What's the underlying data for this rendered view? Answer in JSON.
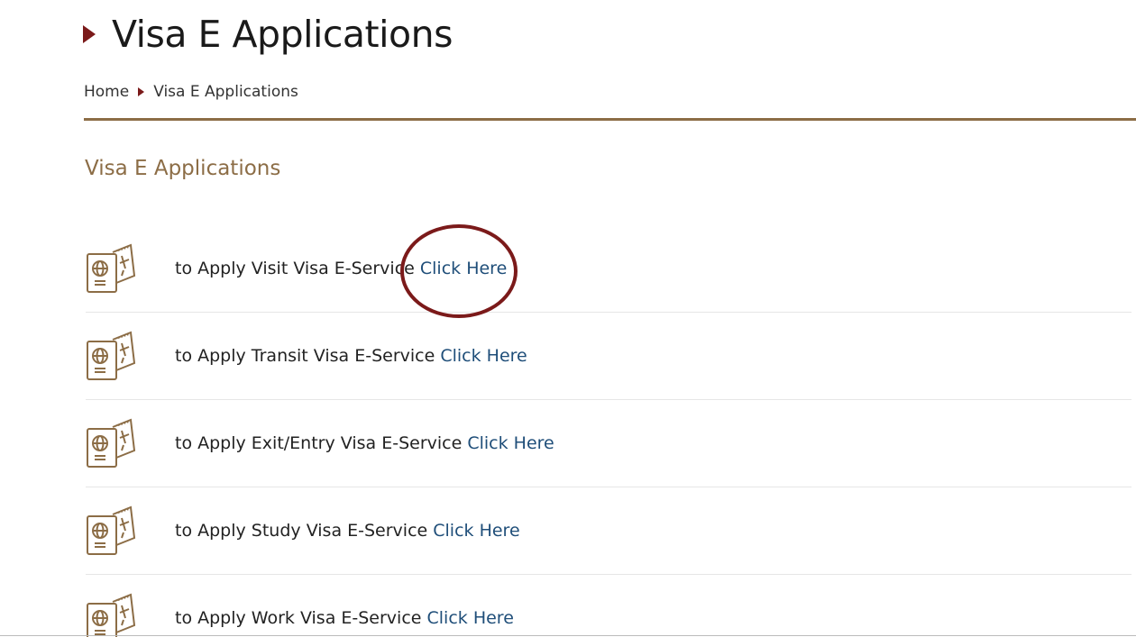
{
  "page": {
    "title": "Visa E Applications"
  },
  "breadcrumb": {
    "home": "Home",
    "current": "Visa E Applications"
  },
  "section": {
    "heading": "Visa E Applications"
  },
  "services": [
    {
      "text": "to Apply Visit Visa E-Service",
      "link": "Click Here",
      "icon": "passport-icon"
    },
    {
      "text": "to Apply Transit Visa E-Service",
      "link": "Click Here",
      "icon": "passport-icon"
    },
    {
      "text": "to Apply Exit/Entry Visa E-Service",
      "link": "Click Here",
      "icon": "passport-icon"
    },
    {
      "text": "to Apply Study Visa E-Service",
      "link": "Click Here",
      "icon": "passport-icon"
    },
    {
      "text": "to Apply Work Visa E-Service",
      "link": "Click Here",
      "icon": "passport-icon"
    }
  ],
  "colors": {
    "accent_brown": "#8c6d46",
    "arrow_maroon": "#7b1a1a",
    "link_blue": "#1f4e79",
    "highlight_circle": "#7b1a1a"
  }
}
